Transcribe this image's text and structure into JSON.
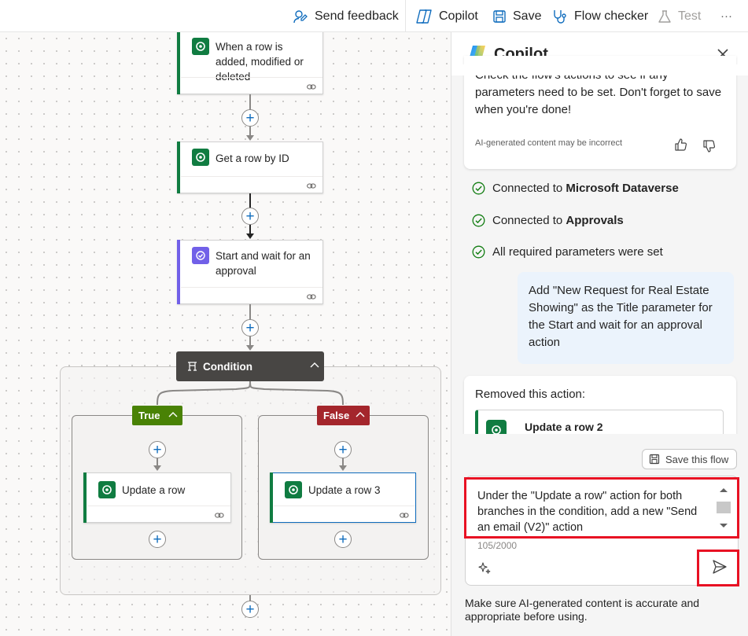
{
  "toolbar": {
    "send_feedback": "Send feedback",
    "copilot": "Copilot",
    "save": "Save",
    "flow_checker": "Flow checker",
    "test": "Test",
    "more": "···"
  },
  "flow": {
    "trigger": {
      "label": "When a row is added, modified or deleted",
      "icon": "dataverse-icon",
      "color": "#107c41"
    },
    "step1": {
      "label": "Get a row by ID",
      "icon": "dataverse-icon",
      "color": "#107c41"
    },
    "step2": {
      "label": "Start and wait for an approval",
      "icon": "approvals-icon",
      "color": "#7160e8"
    },
    "condition": {
      "label": "Condition",
      "color": "#484644"
    },
    "true_branch": {
      "label": "True",
      "color": "#498205",
      "action": "Update a row"
    },
    "false_branch": {
      "label": "False",
      "color": "#a4262c",
      "action": "Update a row 3"
    }
  },
  "copilot": {
    "title": "Copilot",
    "assistant_message": "Check the flow's actions to see if any parameters need to be set. Don't forget to save when you're done!",
    "disclaimer_small": "AI-generated content may be incorrect",
    "status": [
      {
        "prefix": "Connected to ",
        "bold": "Microsoft Dataverse"
      },
      {
        "prefix": "Connected to ",
        "bold": "Approvals"
      },
      {
        "prefix": "All required parameters were set",
        "bold": ""
      }
    ],
    "user_message": "Add \"New Request for Real Estate Showing\" as the Title parameter for the Start and wait for an approval action",
    "removed_title": "Removed this action:",
    "removed_action": "Update a row 2",
    "save_flow": "Save this flow",
    "input_value": "Under the \"Update a row\" action for both branches in the condition, add a new \"Send an email (V2)\" action",
    "char_count": "105/2000",
    "footer": "Make sure AI-generated content is accurate and appropriate before using."
  }
}
